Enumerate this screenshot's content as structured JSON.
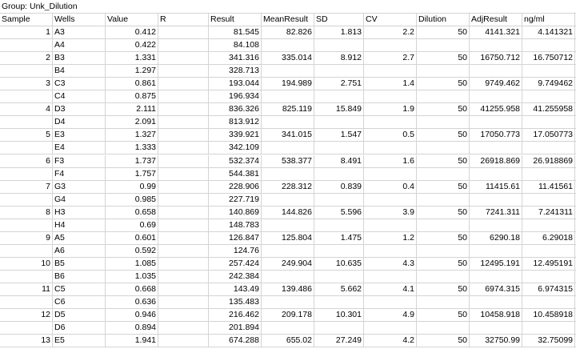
{
  "group_title": "Group: Unk_Dilution",
  "headers": [
    "Sample",
    "Wells",
    "Value",
    "R",
    "Result",
    "MeanResult",
    "SD",
    "CV",
    "Dilution",
    "AdjResult",
    "ng/ml"
  ],
  "rows": [
    {
      "sample": "1",
      "well": "A3",
      "value": "0.412",
      "r": "",
      "result": "81.545",
      "mean": "82.826",
      "sd": "1.813",
      "cv": "2.2",
      "dilution": "50",
      "adj": "4141.321",
      "ngml": "4.141321"
    },
    {
      "sample": "",
      "well": "A4",
      "value": "0.422",
      "r": "",
      "result": "84.108",
      "mean": "",
      "sd": "",
      "cv": "",
      "dilution": "",
      "adj": "",
      "ngml": ""
    },
    {
      "sample": "2",
      "well": "B3",
      "value": "1.331",
      "r": "",
      "result": "341.316",
      "mean": "335.014",
      "sd": "8.912",
      "cv": "2.7",
      "dilution": "50",
      "adj": "16750.712",
      "ngml": "16.750712"
    },
    {
      "sample": "",
      "well": "B4",
      "value": "1.297",
      "r": "",
      "result": "328.713",
      "mean": "",
      "sd": "",
      "cv": "",
      "dilution": "",
      "adj": "",
      "ngml": ""
    },
    {
      "sample": "3",
      "well": "C3",
      "value": "0.861",
      "r": "",
      "result": "193.044",
      "mean": "194.989",
      "sd": "2.751",
      "cv": "1.4",
      "dilution": "50",
      "adj": "9749.462",
      "ngml": "9.749462"
    },
    {
      "sample": "",
      "well": "C4",
      "value": "0.875",
      "r": "",
      "result": "196.934",
      "mean": "",
      "sd": "",
      "cv": "",
      "dilution": "",
      "adj": "",
      "ngml": ""
    },
    {
      "sample": "4",
      "well": "D3",
      "value": "2.111",
      "r": "",
      "result": "836.326",
      "mean": "825.119",
      "sd": "15.849",
      "cv": "1.9",
      "dilution": "50",
      "adj": "41255.958",
      "ngml": "41.255958"
    },
    {
      "sample": "",
      "well": "D4",
      "value": "2.091",
      "r": "",
      "result": "813.912",
      "mean": "",
      "sd": "",
      "cv": "",
      "dilution": "",
      "adj": "",
      "ngml": ""
    },
    {
      "sample": "5",
      "well": "E3",
      "value": "1.327",
      "r": "",
      "result": "339.921",
      "mean": "341.015",
      "sd": "1.547",
      "cv": "0.5",
      "dilution": "50",
      "adj": "17050.773",
      "ngml": "17.050773"
    },
    {
      "sample": "",
      "well": "E4",
      "value": "1.333",
      "r": "",
      "result": "342.109",
      "mean": "",
      "sd": "",
      "cv": "",
      "dilution": "",
      "adj": "",
      "ngml": ""
    },
    {
      "sample": "6",
      "well": "F3",
      "value": "1.737",
      "r": "",
      "result": "532.374",
      "mean": "538.377",
      "sd": "8.491",
      "cv": "1.6",
      "dilution": "50",
      "adj": "26918.869",
      "ngml": "26.918869"
    },
    {
      "sample": "",
      "well": "F4",
      "value": "1.757",
      "r": "",
      "result": "544.381",
      "mean": "",
      "sd": "",
      "cv": "",
      "dilution": "",
      "adj": "",
      "ngml": ""
    },
    {
      "sample": "7",
      "well": "G3",
      "value": "0.99",
      "r": "",
      "result": "228.906",
      "mean": "228.312",
      "sd": "0.839",
      "cv": "0.4",
      "dilution": "50",
      "adj": "11415.61",
      "ngml": "11.41561"
    },
    {
      "sample": "",
      "well": "G4",
      "value": "0.985",
      "r": "",
      "result": "227.719",
      "mean": "",
      "sd": "",
      "cv": "",
      "dilution": "",
      "adj": "",
      "ngml": ""
    },
    {
      "sample": "8",
      "well": "H3",
      "value": "0.658",
      "r": "",
      "result": "140.869",
      "mean": "144.826",
      "sd": "5.596",
      "cv": "3.9",
      "dilution": "50",
      "adj": "7241.311",
      "ngml": "7.241311"
    },
    {
      "sample": "",
      "well": "H4",
      "value": "0.69",
      "r": "",
      "result": "148.783",
      "mean": "",
      "sd": "",
      "cv": "",
      "dilution": "",
      "adj": "",
      "ngml": ""
    },
    {
      "sample": "9",
      "well": "A5",
      "value": "0.601",
      "r": "",
      "result": "126.847",
      "mean": "125.804",
      "sd": "1.475",
      "cv": "1.2",
      "dilution": "50",
      "adj": "6290.18",
      "ngml": "6.29018"
    },
    {
      "sample": "",
      "well": "A6",
      "value": "0.592",
      "r": "",
      "result": "124.76",
      "mean": "",
      "sd": "",
      "cv": "",
      "dilution": "",
      "adj": "",
      "ngml": ""
    },
    {
      "sample": "10",
      "well": "B5",
      "value": "1.085",
      "r": "",
      "result": "257.424",
      "mean": "249.904",
      "sd": "10.635",
      "cv": "4.3",
      "dilution": "50",
      "adj": "12495.191",
      "ngml": "12.495191"
    },
    {
      "sample": "",
      "well": "B6",
      "value": "1.035",
      "r": "",
      "result": "242.384",
      "mean": "",
      "sd": "",
      "cv": "",
      "dilution": "",
      "adj": "",
      "ngml": ""
    },
    {
      "sample": "11",
      "well": "C5",
      "value": "0.668",
      "r": "",
      "result": "143.49",
      "mean": "139.486",
      "sd": "5.662",
      "cv": "4.1",
      "dilution": "50",
      "adj": "6974.315",
      "ngml": "6.974315"
    },
    {
      "sample": "",
      "well": "C6",
      "value": "0.636",
      "r": "",
      "result": "135.483",
      "mean": "",
      "sd": "",
      "cv": "",
      "dilution": "",
      "adj": "",
      "ngml": ""
    },
    {
      "sample": "12",
      "well": "D5",
      "value": "0.946",
      "r": "",
      "result": "216.462",
      "mean": "209.178",
      "sd": "10.301",
      "cv": "4.9",
      "dilution": "50",
      "adj": "10458.918",
      "ngml": "10.458918"
    },
    {
      "sample": "",
      "well": "D6",
      "value": "0.894",
      "r": "",
      "result": "201.894",
      "mean": "",
      "sd": "",
      "cv": "",
      "dilution": "",
      "adj": "",
      "ngml": ""
    },
    {
      "sample": "13",
      "well": "E5",
      "value": "1.941",
      "r": "",
      "result": "674.288",
      "mean": "655.02",
      "sd": "27.249",
      "cv": "4.2",
      "dilution": "50",
      "adj": "32750.99",
      "ngml": "32.75099"
    }
  ]
}
